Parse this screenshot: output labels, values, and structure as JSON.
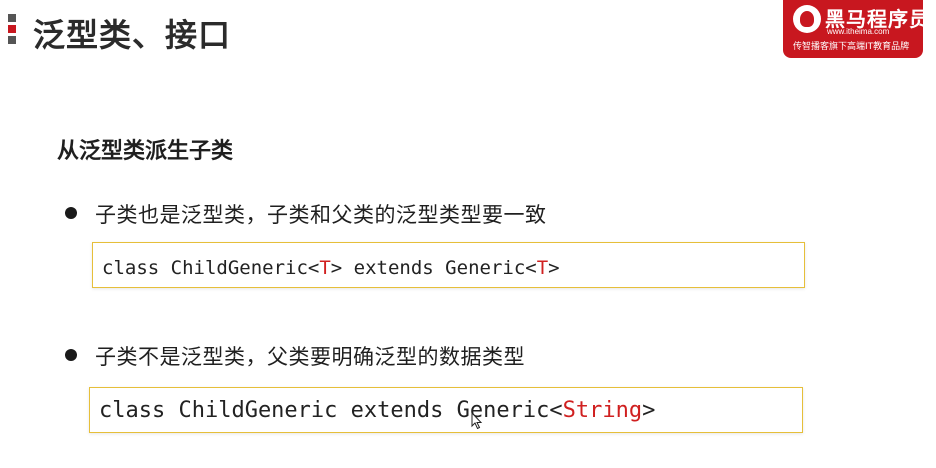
{
  "header": {
    "title": "泛型类、接口",
    "marker_colors": [
      "#555555",
      "#c8171f",
      "#555555"
    ]
  },
  "logo": {
    "name": "黑马程序员",
    "url": "www.itheima.com",
    "slogan": "传智播客旗下高端IT教育品牌",
    "background_color": "#c8171f"
  },
  "section": {
    "heading": "从泛型类派生子类"
  },
  "bullets": [
    {
      "text": "子类也是泛型类，子类和父类的泛型类型要一致",
      "code": [
        {
          "text": "class ChildGeneric<"
        },
        {
          "text": "T",
          "highlight": true
        },
        {
          "text": "> extends Generic<"
        },
        {
          "text": "T",
          "highlight": true
        },
        {
          "text": ">"
        }
      ]
    },
    {
      "text": "子类不是泛型类，父类要明确泛型的数据类型",
      "code": [
        {
          "text": "class ChildGeneric extends Generic<"
        },
        {
          "text": "String",
          "highlight": true
        },
        {
          "text": ">"
        }
      ]
    }
  ],
  "colors": {
    "code_border": "#e6bf3a",
    "code_highlight": "#d02020",
    "text": "#1f1f1f"
  },
  "icons": {
    "cursor": "mouse-pointer-icon",
    "logo": "horse-logo-icon"
  }
}
